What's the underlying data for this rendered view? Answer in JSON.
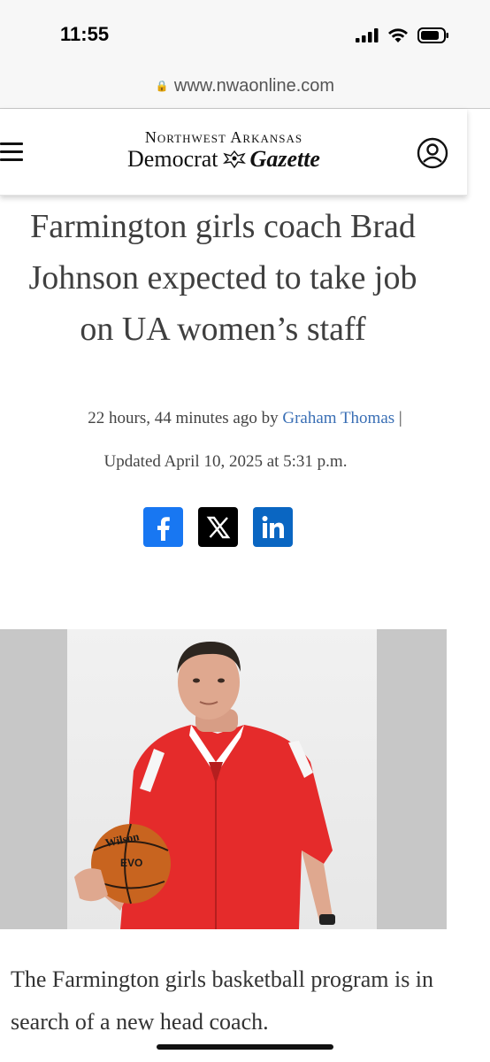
{
  "status_bar": {
    "time": "11:55"
  },
  "browser": {
    "url": "www.nwaonline.com"
  },
  "site": {
    "logo_top": "Northwest Arkansas",
    "logo_left": "Democrat",
    "logo_right": "Gazette"
  },
  "article": {
    "headline": "Farmington girls coach Brad Johnson expected to take job on UA women’s staff",
    "time_ago": "22 hours, 44 minutes ago by",
    "author": "Graham Thomas",
    "separator": "|",
    "updated": "Updated April 10, 2025 at 5:31 p.m.",
    "body_start": "The Farmington girls basketball program is in search of a new head coach."
  },
  "share": {
    "icons": [
      "facebook-icon",
      "x-icon",
      "linkedin-icon"
    ],
    "colors": {
      "facebook": "#1877f2",
      "x": "#000000",
      "linkedin": "#0a66c2"
    }
  },
  "photo": {
    "ball_brand": "Wilson",
    "ball_model": "EVO"
  }
}
